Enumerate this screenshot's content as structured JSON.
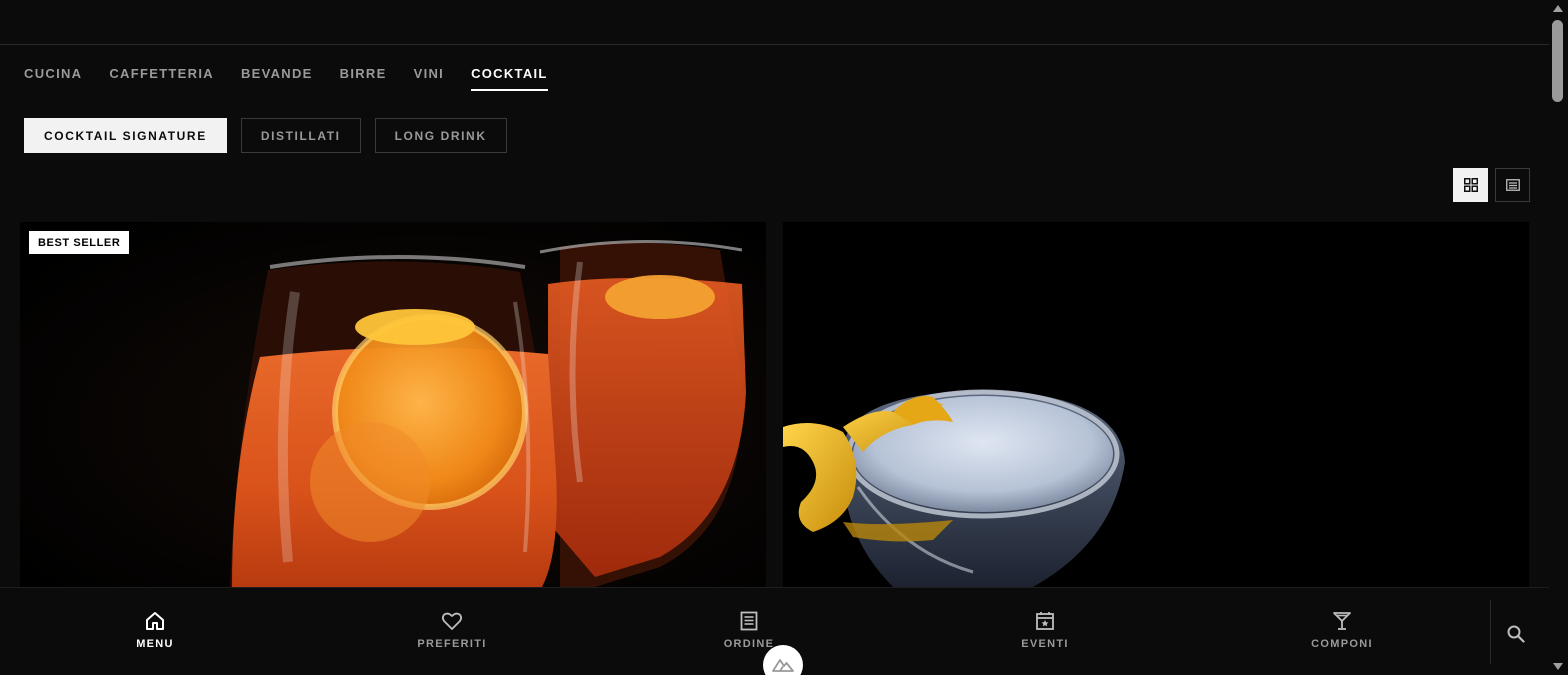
{
  "categories": {
    "items": [
      {
        "label": "CUCINA"
      },
      {
        "label": "CAFFETTERIA"
      },
      {
        "label": "BEVANDE"
      },
      {
        "label": "BIRRE"
      },
      {
        "label": "VINI"
      },
      {
        "label": "COCKTAIL"
      }
    ],
    "active": "COCKTAIL"
  },
  "subcategories": {
    "items": [
      {
        "label": "COCKTAIL SIGNATURE"
      },
      {
        "label": "DISTILLATI"
      },
      {
        "label": "LONG DRINK"
      }
    ],
    "active": "COCKTAIL SIGNATURE"
  },
  "view_toggle": {
    "active": "grid-view",
    "icons": [
      "grid-icon",
      "list-icon"
    ]
  },
  "products": [
    {
      "badge": "BEST SELLER",
      "image": "spritz-cocktail-photo"
    },
    {
      "image": "martini-lemon-twist-photo"
    }
  ],
  "bottom_nav": {
    "items": [
      {
        "label": "MENU",
        "icon": "home-icon"
      },
      {
        "label": "PREFERITI",
        "icon": "heart-icon"
      },
      {
        "label": "ORDINE",
        "icon": "receipt-icon"
      },
      {
        "label": "EVENTI",
        "icon": "calendar-star-icon"
      },
      {
        "label": "COMPONI",
        "icon": "cocktail-glass-icon"
      }
    ],
    "active": "MENU",
    "search_icon": "search-icon",
    "fab_icon": "nuxt-logo-icon"
  },
  "colors": {
    "background": "#0b0b0b",
    "active_text": "#ffffff",
    "inactive_text": "#9a9a9a",
    "border": "#3a3a3a",
    "badge_bg": "#ffffff"
  }
}
